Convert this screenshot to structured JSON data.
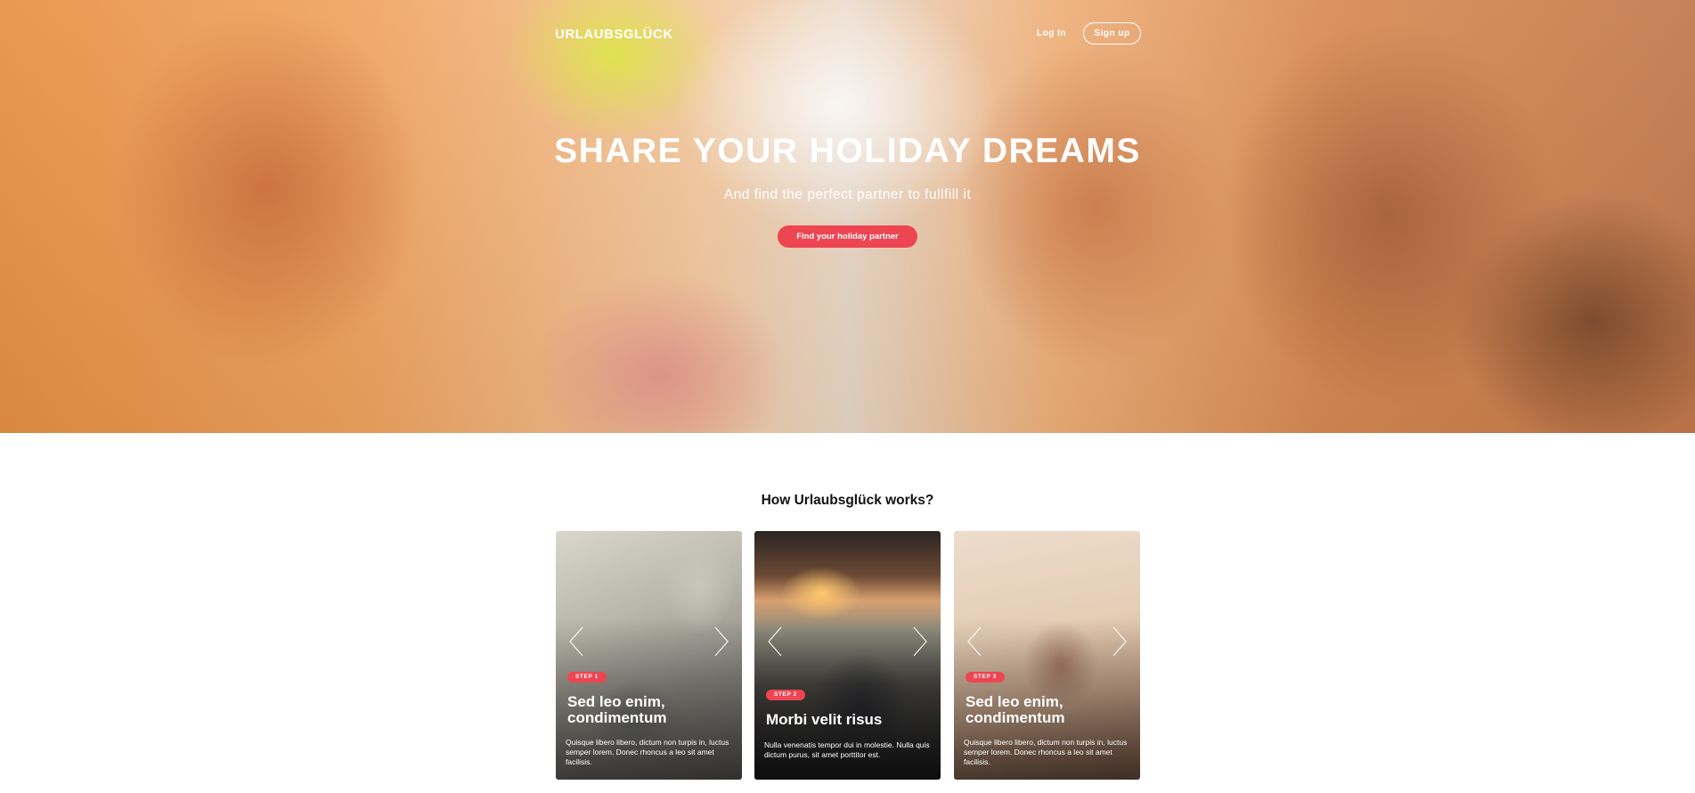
{
  "header": {
    "logo": "URLAUBSGLÜCK",
    "login_label": "Log In",
    "signup_label": "Sign up"
  },
  "hero": {
    "title": "SHARE YOUR HOLIDAY DREAMS",
    "subtitle": "And find the perfect partner to fullfill it",
    "cta_label": "Find your holiday partner"
  },
  "how_it_works": {
    "title": "How Urlaubsglück works?",
    "cards": [
      {
        "step": "STEP 1",
        "title": "Sed leo enim, condimentum",
        "text": "Quisque libero libero, dictum non turpis in, luctus semper lorem. Donec rhoncus a leo sit amet facilisis."
      },
      {
        "step": "STEP 2",
        "title": "Morbi velit risus",
        "text": "Nulla venenatis tempor dui in molestie. Nulla quis dictum purus, sit amet porttitor est."
      },
      {
        "step": "STEP 3",
        "title": "Sed leo enim, condimentum",
        "text": "Quisque libero libero, dictum non turpis in, luctus semper lorem. Donec rhoncus a leo sit amet facilisis."
      }
    ]
  },
  "colors": {
    "accent": "#ee4552",
    "text_dark": "#111111"
  },
  "icons": [
    "chevron-left-icon",
    "chevron-right-icon"
  ]
}
